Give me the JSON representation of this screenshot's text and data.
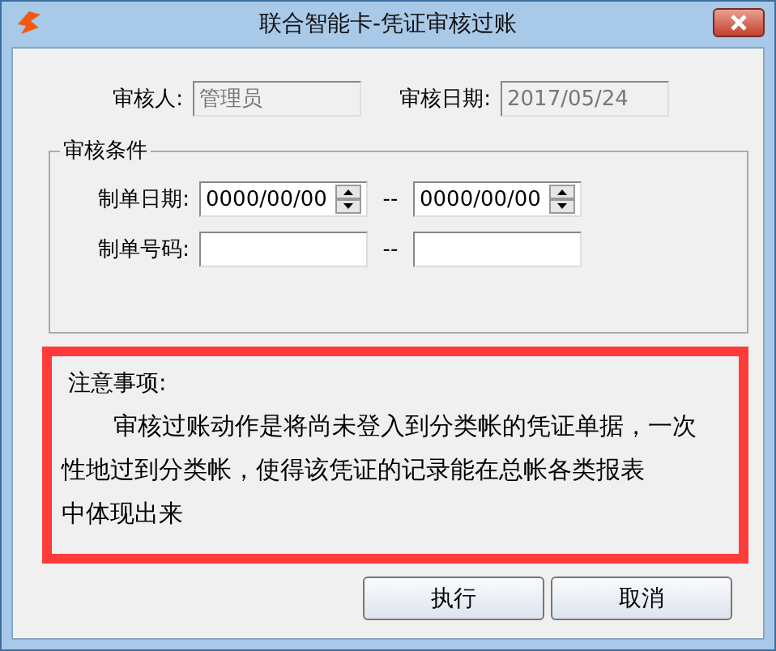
{
  "window": {
    "title": "联合智能卡-凭证审核过账"
  },
  "auditor": {
    "label": "审核人:",
    "value": "管理员",
    "disabled": true
  },
  "audit_date": {
    "label": "审核日期:",
    "value": "2017/05/24",
    "disabled": true
  },
  "conditions": {
    "title": "审核条件",
    "rows": [
      {
        "kind": "date",
        "label": "制单日期:",
        "from": "0000/00/00",
        "separator": "--",
        "to": "0000/00/00"
      },
      {
        "kind": "text",
        "label": "制单号码:",
        "from": "",
        "separator": "--",
        "to": ""
      }
    ]
  },
  "note": {
    "title": "注意事项:",
    "lines": [
      "审核过账动作是将尚未登入到分类帐的凭证单据，一次",
      "性地过到分类帐，使得该凭证的记录能在总帐各类报表",
      "中体现出来"
    ]
  },
  "buttons": [
    "执行",
    "取消"
  ]
}
